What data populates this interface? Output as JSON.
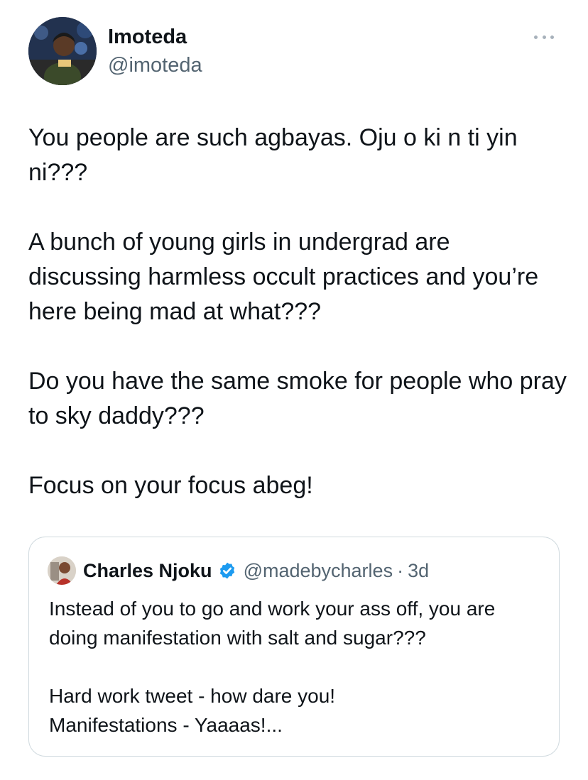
{
  "author": {
    "name": "Imoteda",
    "handle": "@imoteda",
    "avatar_icon": "user-avatar"
  },
  "more_icon": "ellipsis-icon",
  "tweet": {
    "paragraphs": [
      "You people are such agbayas. Oju o ki n ti yin ni???",
      "A bunch of young girls in undergrad are discussing harmless occult practices and you’re here being mad at what???",
      "Do you have the same smoke for people who pray to sky daddy???",
      "Focus on your focus abeg!"
    ]
  },
  "quoted_tweet": {
    "name": "Charles Njoku",
    "verified": true,
    "handle": "@madebycharles",
    "separator": "·",
    "time": "3d",
    "paragraphs": [
      "Instead of you to go and work your ass off, you are doing manifestation with salt and sugar???",
      "Hard work tweet - how dare you!\nManifestations - Yaaaas!..."
    ]
  },
  "colors": {
    "text": "#0f1419",
    "secondary": "#536471",
    "border": "#cfd9de",
    "verified": "#1d9bf0"
  }
}
